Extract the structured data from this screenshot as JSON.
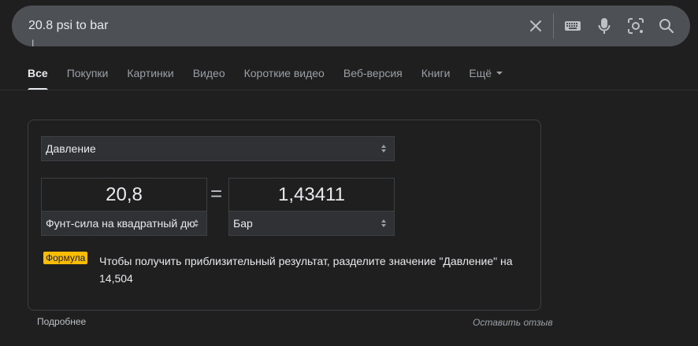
{
  "search": {
    "query": "20.8 psi to bar"
  },
  "icons": {
    "clear": "close-icon",
    "keyboard": "keyboard-icon",
    "voice": "microphone-icon",
    "lens": "lens-camera-icon",
    "search": "search-icon"
  },
  "tabs": [
    {
      "label": "Все",
      "active": true
    },
    {
      "label": "Покупки",
      "active": false
    },
    {
      "label": "Картинки",
      "active": false
    },
    {
      "label": "Видео",
      "active": false
    },
    {
      "label": "Короткие видео",
      "active": false
    },
    {
      "label": "Веб-версия",
      "active": false
    },
    {
      "label": "Книги",
      "active": false
    },
    {
      "label": "Ещё",
      "active": false
    }
  ],
  "converter": {
    "category": "Давление",
    "equals_sign": "=",
    "from_value": "20,8",
    "from_unit": "Фунт-сила на квадратный дюйм",
    "to_value": "1,43411",
    "to_unit": "Бар",
    "formula_badge": "Формула",
    "formula_text": "Чтобы получить приблизительный результат, разделите значение \"Давление\" на 14,504"
  },
  "footer": {
    "more": "Подробнее",
    "feedback": "Оставить отзыв"
  },
  "colors": {
    "background": "#1f1f1f",
    "search_bar": "#4d5156",
    "formula_badge": "#fbbc04",
    "select_bg": "#303134"
  }
}
